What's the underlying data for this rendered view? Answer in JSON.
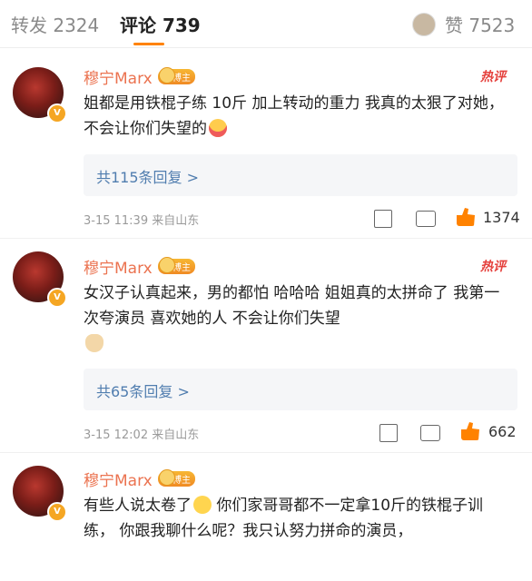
{
  "tabs": {
    "repost": "转发 2324",
    "comments": "评论 739",
    "likes": "赞 7523"
  },
  "comments": [
    {
      "user": "穆宁Marx",
      "badge": "博主",
      "hot": "热评",
      "text": "姐都是用铁棍子练 10斤  加上转动的重力  我真的太狠了对她，不会让你们失望的",
      "replies": "共115条回复 >",
      "meta": "3-15 11:39 来自山东",
      "likes": "1374"
    },
    {
      "user": "穆宁Marx",
      "badge": "博主",
      "hot": "热评",
      "text": "女汉子认真起来，男的都怕  哈哈哈  姐姐真的太拼命了  我第一次夸演员  喜欢她的人 不会让你们失望",
      "replies": "共65条回复 >",
      "meta": "3-15 12:02 来自山东",
      "likes": "662"
    },
    {
      "user": "穆宁Marx",
      "badge": "博主",
      "text_a": "有些人说太卷了",
      "text_b": " 你们家哥哥都不一定拿10斤的铁棍子训练，  你跟我聊什么呢？我只认努力拼命的演员，"
    }
  ],
  "icons": {
    "share": "share-icon",
    "comment": "comment-icon",
    "like": "thumbs-up-icon"
  }
}
